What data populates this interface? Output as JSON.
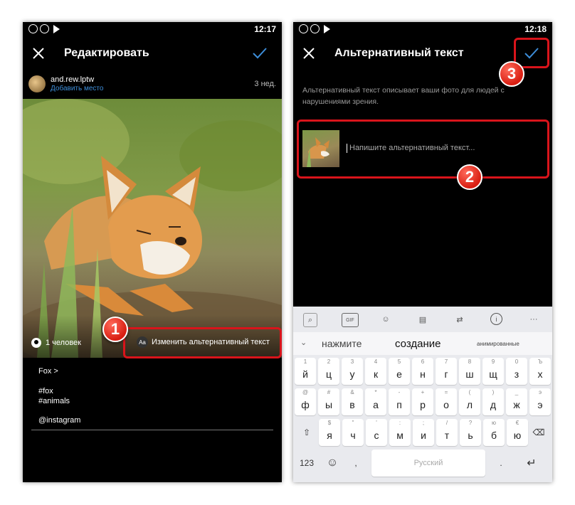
{
  "left_screen": {
    "status_time": "12:17",
    "title": "Редактировать",
    "user": {
      "name": "and.rew.lptw",
      "place_link": "Добавить место",
      "time_ago": "3 нед."
    },
    "photo_overlay": {
      "tagged_people": "1 человек",
      "edit_alt_text": "Изменить альтернативный текст"
    },
    "caption": {
      "line1": "Fox >",
      "line2": "#fox",
      "line3": "#animals",
      "line4": "@instagram"
    }
  },
  "right_screen": {
    "status_time": "12:18",
    "title": "Альтернативный текст",
    "description": "Альтернативный текст описывает ваши фото для людей с нарушениями зрения.",
    "input_placeholder": "Напишите альтернативный текст...",
    "keyboard": {
      "suggestions": [
        "нажмите",
        "создание",
        "анимированные"
      ],
      "tool_gif": "GIF",
      "tool_more": "···",
      "row1": [
        {
          "main": "й",
          "sub": "1"
        },
        {
          "main": "ц",
          "sub": "2"
        },
        {
          "main": "у",
          "sub": "3"
        },
        {
          "main": "к",
          "sub": "4"
        },
        {
          "main": "е",
          "sub": "5"
        },
        {
          "main": "н",
          "sub": "6"
        },
        {
          "main": "г",
          "sub": "7"
        },
        {
          "main": "ш",
          "sub": "8"
        },
        {
          "main": "щ",
          "sub": "9"
        },
        {
          "main": "з",
          "sub": "0"
        },
        {
          "main": "х",
          "sub": "Ъ"
        }
      ],
      "row2": [
        {
          "main": "ф",
          "sub": "@"
        },
        {
          "main": "ы",
          "sub": "#"
        },
        {
          "main": "в",
          "sub": "&"
        },
        {
          "main": "а",
          "sub": "*"
        },
        {
          "main": "п",
          "sub": "-"
        },
        {
          "main": "р",
          "sub": "+"
        },
        {
          "main": "о",
          "sub": "="
        },
        {
          "main": "л",
          "sub": "("
        },
        {
          "main": "д",
          "sub": ")"
        },
        {
          "main": "ж",
          "sub": "_"
        },
        {
          "main": "э",
          "sub": "э"
        }
      ],
      "row3": [
        {
          "main": "я",
          "sub": "$"
        },
        {
          "main": "ч",
          "sub": "\""
        },
        {
          "main": "с",
          "sub": "'"
        },
        {
          "main": "м",
          "sub": ":"
        },
        {
          "main": "и",
          "sub": ";"
        },
        {
          "main": "т",
          "sub": "/"
        },
        {
          "main": "ь",
          "sub": "?"
        },
        {
          "main": "б",
          "sub": "ю"
        },
        {
          "main": "ю",
          "sub": "€"
        }
      ],
      "numbers_key": "123",
      "space_label": "Русский"
    }
  },
  "step_badges": {
    "one": "1",
    "two": "2",
    "three": "3"
  }
}
